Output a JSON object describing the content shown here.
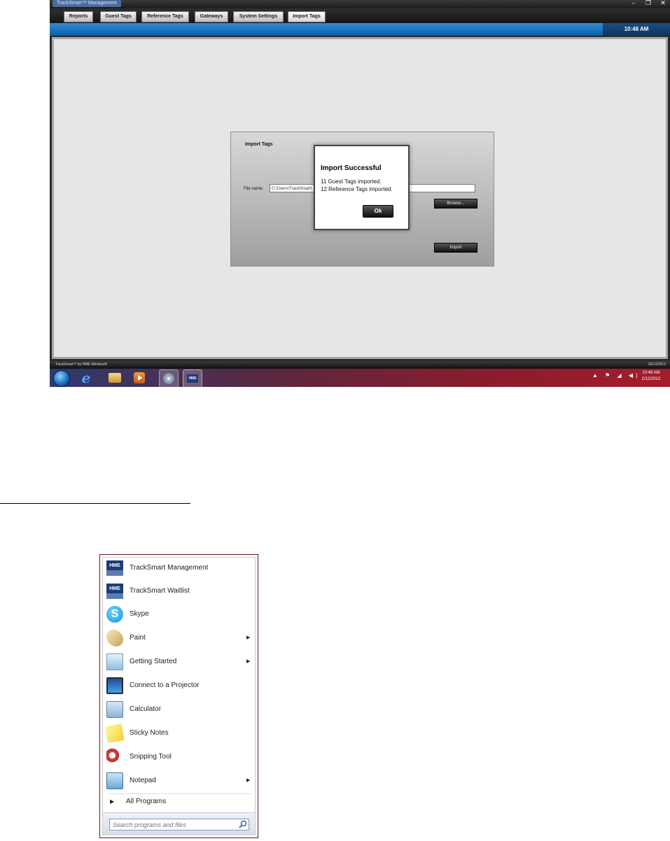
{
  "app": {
    "title": "TrackSmart™ Management",
    "window_controls": {
      "minimize": "–",
      "maximize": "❐",
      "close": "✕"
    },
    "nav_tabs": [
      "Reports",
      "Guest Tags",
      "Reference Tags",
      "Gateways",
      "System Settings",
      "Import Tags"
    ],
    "active_tab": "Import Tags",
    "status_clock": "10:48 AM",
    "import_panel": {
      "title": "Import Tags",
      "file_label": "File name:",
      "file_value": "C:\\Users\\TrackSmart\\",
      "browse_label": "Browse...",
      "import_label": "Import"
    },
    "dialog": {
      "title": "Import Successful",
      "line1": "11 Guest Tags imported.",
      "line2": "12 Reference Tags imported.",
      "ok_label": "Ok"
    },
    "footer": {
      "left": "TrackSmart™ by HME Wireless®",
      "right": "02/12/2012"
    }
  },
  "taskbar": {
    "tray_icons": "▲ ⚑ ◢ ◀)",
    "time": "10:48 AM",
    "date": "2/12/2012"
  },
  "start_menu": {
    "items": [
      {
        "label": "TrackSmart Management",
        "icon": "hme-icon",
        "submenu": false
      },
      {
        "label": "TrackSmart Waitlist",
        "icon": "hme-icon",
        "submenu": false
      },
      {
        "label": "Skype",
        "icon": "skype-icon",
        "submenu": false
      },
      {
        "label": "Paint",
        "icon": "paint-icon",
        "submenu": true
      },
      {
        "label": "Getting Started",
        "icon": "getting-started-icon",
        "submenu": true
      },
      {
        "label": "Connect to a Projector",
        "icon": "projector-icon",
        "submenu": false
      },
      {
        "label": "Calculator",
        "icon": "calculator-icon",
        "submenu": false
      },
      {
        "label": "Sticky Notes",
        "icon": "sticky-notes-icon",
        "submenu": false
      },
      {
        "label": "Snipping Tool",
        "icon": "snipping-tool-icon",
        "submenu": false
      },
      {
        "label": "Notepad",
        "icon": "notepad-icon",
        "submenu": true
      }
    ],
    "hme_icon_text": "HME",
    "skype_icon_text": "S",
    "submenu_arrow": "▶",
    "all_programs": "All Programs",
    "search_placeholder": "Search programs and files"
  }
}
